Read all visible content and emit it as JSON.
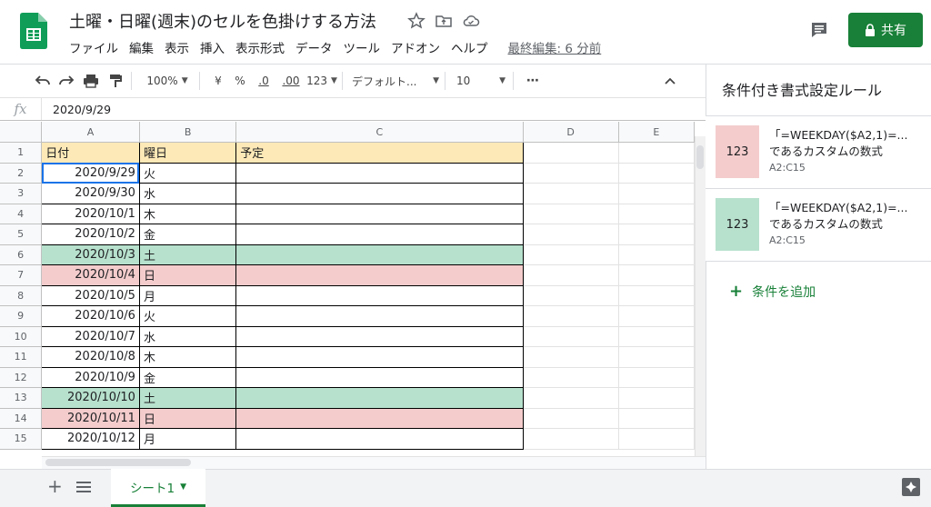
{
  "header": {
    "title": "土曜・日曜(週末)のセルを色掛けする方法",
    "menu": [
      "ファイル",
      "編集",
      "表示",
      "挿入",
      "表示形式",
      "データ",
      "ツール",
      "アドオン",
      "ヘルプ"
    ],
    "last_edit": "最終編集: 6 分前",
    "share_label": "共有",
    "brand_color": "#188038"
  },
  "toolbar": {
    "zoom": "100%",
    "currency": "¥",
    "percent": "%",
    "dec_less": ".0",
    "dec_more": ".00",
    "format_more": "123",
    "font": "デフォルト...",
    "font_size": "10",
    "more": "⋯"
  },
  "formula_bar": {
    "fx": "fx",
    "value": "2020/9/29"
  },
  "columns": [
    "A",
    "B",
    "C",
    "D",
    "E"
  ],
  "rows": [
    {
      "n": "1",
      "a": "日付",
      "b": "曜日",
      "c": "予定",
      "kind": "hdr"
    },
    {
      "n": "2",
      "a": "2020/9/29",
      "b": "火",
      "c": "",
      "kind": ""
    },
    {
      "n": "3",
      "a": "2020/9/30",
      "b": "水",
      "c": "",
      "kind": ""
    },
    {
      "n": "4",
      "a": "2020/10/1",
      "b": "木",
      "c": "",
      "kind": ""
    },
    {
      "n": "5",
      "a": "2020/10/2",
      "b": "金",
      "c": "",
      "kind": ""
    },
    {
      "n": "6",
      "a": "2020/10/3",
      "b": "土",
      "c": "",
      "kind": "sat"
    },
    {
      "n": "7",
      "a": "2020/10/4",
      "b": "日",
      "c": "",
      "kind": "sun"
    },
    {
      "n": "8",
      "a": "2020/10/5",
      "b": "月",
      "c": "",
      "kind": ""
    },
    {
      "n": "9",
      "a": "2020/10/6",
      "b": "火",
      "c": "",
      "kind": ""
    },
    {
      "n": "10",
      "a": "2020/10/7",
      "b": "水",
      "c": "",
      "kind": ""
    },
    {
      "n": "11",
      "a": "2020/10/8",
      "b": "木",
      "c": "",
      "kind": ""
    },
    {
      "n": "12",
      "a": "2020/10/9",
      "b": "金",
      "c": "",
      "kind": ""
    },
    {
      "n": "13",
      "a": "2020/10/10",
      "b": "土",
      "c": "",
      "kind": "sat"
    },
    {
      "n": "14",
      "a": "2020/10/11",
      "b": "日",
      "c": "",
      "kind": "sun"
    },
    {
      "n": "15",
      "a": "2020/10/12",
      "b": "月",
      "c": "",
      "kind": ""
    }
  ],
  "colors": {
    "header_fill": "#fde9b7",
    "saturday_fill": "#b7e1cd",
    "sunday_fill": "#f4cccc",
    "selection": "#1a73e8"
  },
  "sheet_tabs": [
    {
      "label": "シート1"
    }
  ],
  "panel": {
    "title": "条件付き書式設定ルール",
    "rules": [
      {
        "swatch_text": "123",
        "formula": "「=WEEKDAY($A2,1)=...",
        "desc": "であるカスタムの数式",
        "range": "A2:C15",
        "color": "#f4cccc"
      },
      {
        "swatch_text": "123",
        "formula": "「=WEEKDAY($A2,1)=...",
        "desc": "であるカスタムの数式",
        "range": "A2:C15",
        "color": "#b7e1cd"
      }
    ],
    "add_rule": "条件を追加"
  }
}
